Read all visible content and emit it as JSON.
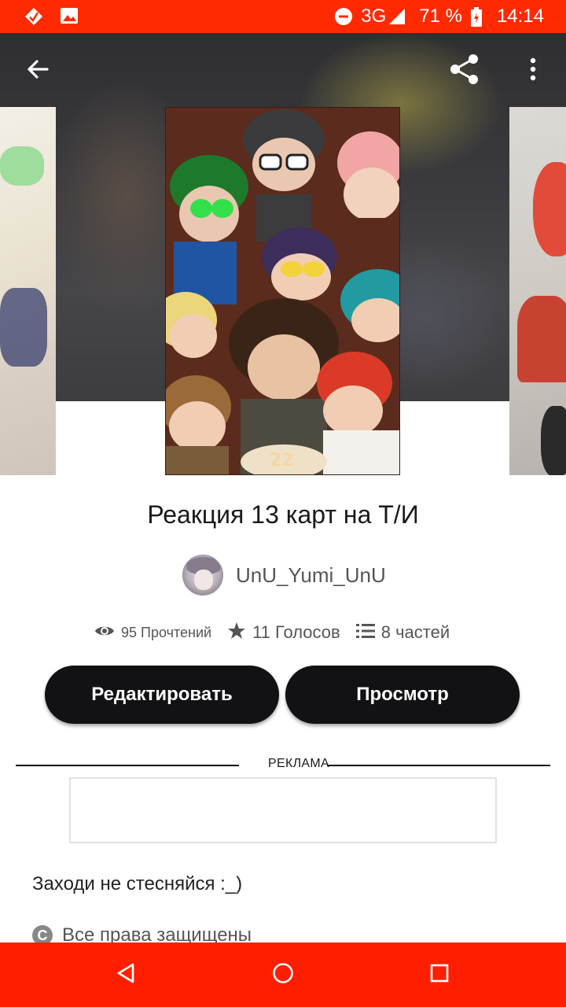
{
  "status_bar": {
    "network": "3G",
    "battery_percent": "71 %",
    "time": "14:14",
    "icons": [
      "notification-diamond-icon",
      "image-icon",
      "do-not-disturb-icon",
      "signal-icon",
      "battery-charging-icon"
    ]
  },
  "toolbar": {
    "icons": [
      "back-arrow-icon",
      "share-icon",
      "more-vert-icon"
    ]
  },
  "story": {
    "title": "Реакция 13 карт на Т/И",
    "author": "UnU_Yumi_UnU",
    "cover_badge_text": "22",
    "stats": {
      "reads": "95 Прочтений",
      "votes": "11 Голосов",
      "parts": "8 частей"
    }
  },
  "actions": {
    "edit_label": "Редактировать",
    "preview_label": "Просмотр"
  },
  "ad": {
    "label": "РЕКЛАМА"
  },
  "description": "Заходи не стесняйся :_)",
  "copyright": "Все права защищены",
  "nav_bar": {
    "icons": [
      "nav-back-icon",
      "nav-home-icon",
      "nav-recents-icon"
    ]
  },
  "colors": {
    "status_bar": "#ff2a00",
    "nav_bar": "#ff1e00",
    "button_bg": "#121113",
    "button_text": "#ffffff"
  }
}
